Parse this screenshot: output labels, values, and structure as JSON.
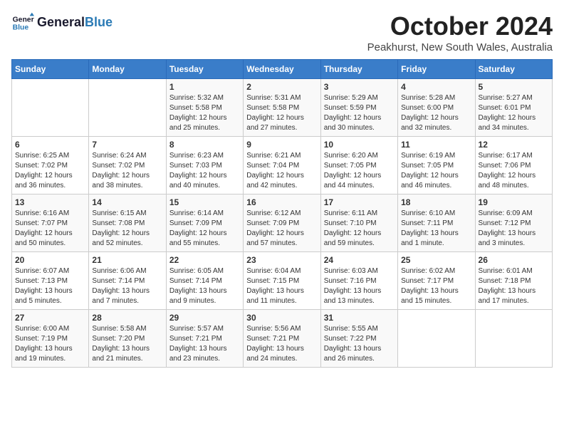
{
  "header": {
    "logo_line1": "General",
    "logo_line2": "Blue",
    "month": "October 2024",
    "location": "Peakhurst, New South Wales, Australia"
  },
  "days_of_week": [
    "Sunday",
    "Monday",
    "Tuesday",
    "Wednesday",
    "Thursday",
    "Friday",
    "Saturday"
  ],
  "weeks": [
    [
      {
        "day": "",
        "info": ""
      },
      {
        "day": "",
        "info": ""
      },
      {
        "day": "1",
        "info": "Sunrise: 5:32 AM\nSunset: 5:58 PM\nDaylight: 12 hours\nand 25 minutes."
      },
      {
        "day": "2",
        "info": "Sunrise: 5:31 AM\nSunset: 5:58 PM\nDaylight: 12 hours\nand 27 minutes."
      },
      {
        "day": "3",
        "info": "Sunrise: 5:29 AM\nSunset: 5:59 PM\nDaylight: 12 hours\nand 30 minutes."
      },
      {
        "day": "4",
        "info": "Sunrise: 5:28 AM\nSunset: 6:00 PM\nDaylight: 12 hours\nand 32 minutes."
      },
      {
        "day": "5",
        "info": "Sunrise: 5:27 AM\nSunset: 6:01 PM\nDaylight: 12 hours\nand 34 minutes."
      }
    ],
    [
      {
        "day": "6",
        "info": "Sunrise: 6:25 AM\nSunset: 7:02 PM\nDaylight: 12 hours\nand 36 minutes."
      },
      {
        "day": "7",
        "info": "Sunrise: 6:24 AM\nSunset: 7:02 PM\nDaylight: 12 hours\nand 38 minutes."
      },
      {
        "day": "8",
        "info": "Sunrise: 6:23 AM\nSunset: 7:03 PM\nDaylight: 12 hours\nand 40 minutes."
      },
      {
        "day": "9",
        "info": "Sunrise: 6:21 AM\nSunset: 7:04 PM\nDaylight: 12 hours\nand 42 minutes."
      },
      {
        "day": "10",
        "info": "Sunrise: 6:20 AM\nSunset: 7:05 PM\nDaylight: 12 hours\nand 44 minutes."
      },
      {
        "day": "11",
        "info": "Sunrise: 6:19 AM\nSunset: 7:05 PM\nDaylight: 12 hours\nand 46 minutes."
      },
      {
        "day": "12",
        "info": "Sunrise: 6:17 AM\nSunset: 7:06 PM\nDaylight: 12 hours\nand 48 minutes."
      }
    ],
    [
      {
        "day": "13",
        "info": "Sunrise: 6:16 AM\nSunset: 7:07 PM\nDaylight: 12 hours\nand 50 minutes."
      },
      {
        "day": "14",
        "info": "Sunrise: 6:15 AM\nSunset: 7:08 PM\nDaylight: 12 hours\nand 52 minutes."
      },
      {
        "day": "15",
        "info": "Sunrise: 6:14 AM\nSunset: 7:09 PM\nDaylight: 12 hours\nand 55 minutes."
      },
      {
        "day": "16",
        "info": "Sunrise: 6:12 AM\nSunset: 7:09 PM\nDaylight: 12 hours\nand 57 minutes."
      },
      {
        "day": "17",
        "info": "Sunrise: 6:11 AM\nSunset: 7:10 PM\nDaylight: 12 hours\nand 59 minutes."
      },
      {
        "day": "18",
        "info": "Sunrise: 6:10 AM\nSunset: 7:11 PM\nDaylight: 13 hours\nand 1 minute."
      },
      {
        "day": "19",
        "info": "Sunrise: 6:09 AM\nSunset: 7:12 PM\nDaylight: 13 hours\nand 3 minutes."
      }
    ],
    [
      {
        "day": "20",
        "info": "Sunrise: 6:07 AM\nSunset: 7:13 PM\nDaylight: 13 hours\nand 5 minutes."
      },
      {
        "day": "21",
        "info": "Sunrise: 6:06 AM\nSunset: 7:14 PM\nDaylight: 13 hours\nand 7 minutes."
      },
      {
        "day": "22",
        "info": "Sunrise: 6:05 AM\nSunset: 7:14 PM\nDaylight: 13 hours\nand 9 minutes."
      },
      {
        "day": "23",
        "info": "Sunrise: 6:04 AM\nSunset: 7:15 PM\nDaylight: 13 hours\nand 11 minutes."
      },
      {
        "day": "24",
        "info": "Sunrise: 6:03 AM\nSunset: 7:16 PM\nDaylight: 13 hours\nand 13 minutes."
      },
      {
        "day": "25",
        "info": "Sunrise: 6:02 AM\nSunset: 7:17 PM\nDaylight: 13 hours\nand 15 minutes."
      },
      {
        "day": "26",
        "info": "Sunrise: 6:01 AM\nSunset: 7:18 PM\nDaylight: 13 hours\nand 17 minutes."
      }
    ],
    [
      {
        "day": "27",
        "info": "Sunrise: 6:00 AM\nSunset: 7:19 PM\nDaylight: 13 hours\nand 19 minutes."
      },
      {
        "day": "28",
        "info": "Sunrise: 5:58 AM\nSunset: 7:20 PM\nDaylight: 13 hours\nand 21 minutes."
      },
      {
        "day": "29",
        "info": "Sunrise: 5:57 AM\nSunset: 7:21 PM\nDaylight: 13 hours\nand 23 minutes."
      },
      {
        "day": "30",
        "info": "Sunrise: 5:56 AM\nSunset: 7:21 PM\nDaylight: 13 hours\nand 24 minutes."
      },
      {
        "day": "31",
        "info": "Sunrise: 5:55 AM\nSunset: 7:22 PM\nDaylight: 13 hours\nand 26 minutes."
      },
      {
        "day": "",
        "info": ""
      },
      {
        "day": "",
        "info": ""
      }
    ]
  ]
}
